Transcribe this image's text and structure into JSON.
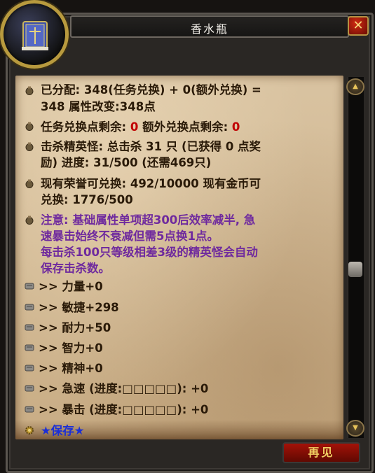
{
  "window": {
    "title": "香水瓶",
    "close_glyph": "✕",
    "goodbye_label": "再见"
  },
  "info": {
    "allocated_l1": "已分配: 348(任务兑换) + 0(额外兑换) =",
    "allocated_l2": "348  属性改变:348点",
    "remaining_prefix": "任务兑换点剩余: ",
    "remaining_quest": "0",
    "remaining_mid": "  额外兑换点剩余: ",
    "remaining_extra": "0",
    "elite_l1": "击杀精英怪: 总击杀 31 只 (已获得 0 点奖",
    "elite_l2": "励) 进度: 31/500 (还需469只)",
    "honor_l1": "现有荣誉可兑换: 492/10000  现有金币可",
    "honor_l2": "兑换: 1776/500",
    "note_l1": "注意: 基础属性单项超300后效率减半, 急",
    "note_l2": "速暴击始终不衰减但需5点换1点。",
    "note_l3": "每击杀100只等级相差3级的精英怪会自动",
    "note_l4": "保存击杀数。"
  },
  "stats": [
    {
      "label": ">> 力量+0"
    },
    {
      "label": ">> 敏捷+298"
    },
    {
      "label": ">> 耐力+50"
    },
    {
      "label": ">> 智力+0"
    },
    {
      "label": ">> 精神+0"
    },
    {
      "label": ">> 急速 (进度:□□□□□):  +0"
    },
    {
      "label": ">> 暴击 (进度:□□□□□):  +0"
    }
  ],
  "save": {
    "label": "★保存★"
  },
  "colors": {
    "parchment": "#d4bc96",
    "text_dark": "#2a1a08",
    "warning_red": "#c00000",
    "note_purple": "#6f2a9e",
    "save_blue": "#1b2fd6",
    "button_red": "#a31208",
    "gold": "#f1d063"
  },
  "icons": {
    "portrait": "blue-book-icon",
    "info_bullet": "money-bag-icon",
    "stat_bullet": "scroll-icon",
    "save_bullet": "gear-icon"
  }
}
